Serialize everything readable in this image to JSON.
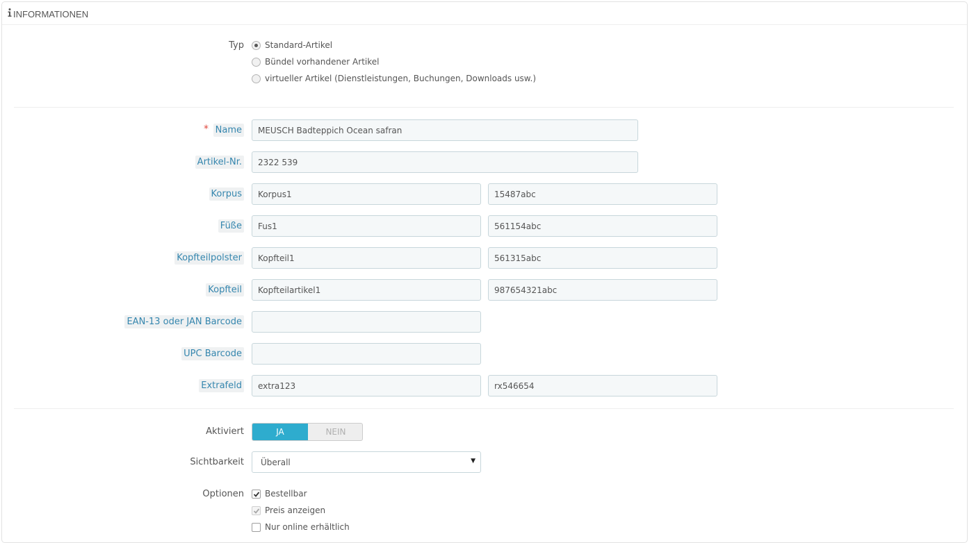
{
  "panel": {
    "title": "INFORMATIONEN",
    "icon": "info-icon"
  },
  "type_section": {
    "label": "Typ",
    "options": [
      {
        "label": "Standard-Artikel",
        "selected": true
      },
      {
        "label": "Bündel vorhandener Artikel",
        "selected": false
      },
      {
        "label": "virtueller Artikel (Dienstleistungen, Buchungen, Downloads usw.)",
        "selected": false
      }
    ]
  },
  "fields": {
    "name": {
      "label": "Name",
      "required_mark": "*",
      "value": "MEUSCH Badteppich Ocean safran"
    },
    "reference": {
      "label": "Artikel-Nr.",
      "value": "2322 539"
    },
    "korpus": {
      "label": "Korpus",
      "value1": "Korpus1",
      "value2": "15487abc"
    },
    "fuesse": {
      "label": "Füße",
      "value1": "Fus1",
      "value2": "561154abc"
    },
    "kopfteilpolster": {
      "label": "Kopfteilpolster",
      "value1": "Kopfteil1",
      "value2": "561315abc"
    },
    "kopfteil": {
      "label": "Kopfteil",
      "value1": "Kopfteilartikel1",
      "value2": "987654321abc"
    },
    "ean13": {
      "label": "EAN-13 oder JAN Barcode",
      "value": ""
    },
    "upc": {
      "label": "UPC Barcode",
      "value": ""
    },
    "extrafeld": {
      "label": "Extrafeld",
      "value1": "extra123",
      "value2": "rx546654"
    }
  },
  "active": {
    "label": "Aktiviert",
    "on_label": "JA",
    "off_label": "NEIN",
    "state": "JA"
  },
  "visibility": {
    "label": "Sichtbarkeit",
    "value": "Überall",
    "icon": "caret-down-icon"
  },
  "options": {
    "label": "Optionen",
    "items": [
      {
        "label": "Bestellbar",
        "checked": true,
        "disabled": false
      },
      {
        "label": "Preis anzeigen",
        "checked": true,
        "disabled": true
      },
      {
        "label": "Nur online erhältlich",
        "checked": false,
        "disabled": false
      }
    ]
  },
  "colors": {
    "accent": "#2eacce",
    "hint_text": "#3586ae",
    "required": "#e0493f"
  }
}
